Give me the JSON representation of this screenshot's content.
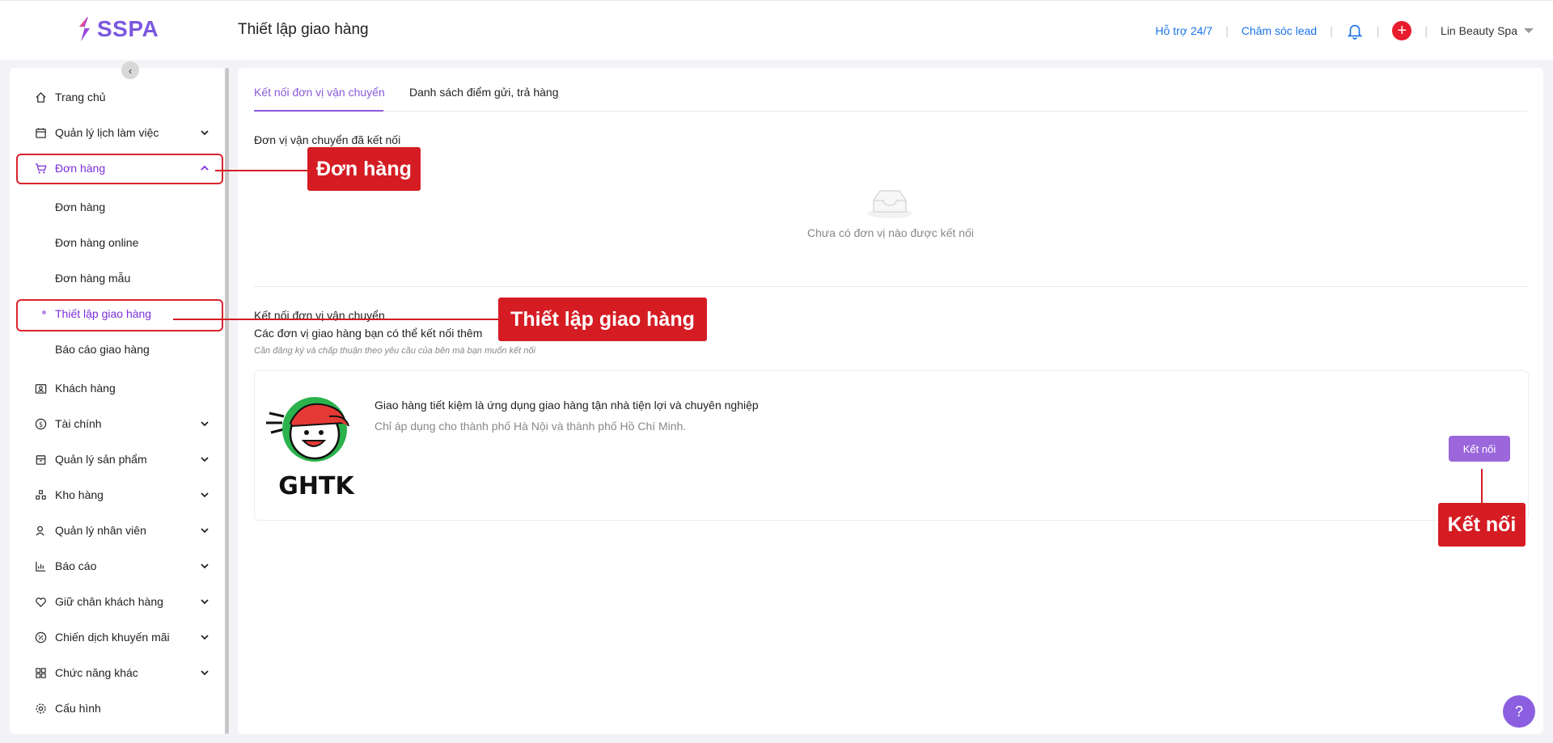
{
  "header": {
    "logo_text": "SSPA",
    "page_title": "Thiết lập giao hàng",
    "support_link": "Hỗ trợ 24/7",
    "lead_link": "Chăm sóc lead",
    "user_name": "Lin Beauty Spa"
  },
  "sidebar": {
    "items": [
      {
        "label": "Trang chủ",
        "icon": "home-icon"
      },
      {
        "label": "Quản lý lịch làm việc",
        "icon": "calendar-icon"
      },
      {
        "label": "Đơn hàng",
        "icon": "cart-icon"
      },
      {
        "label": "Khách hàng",
        "icon": "contact-card-icon"
      },
      {
        "label": "Tài chính",
        "icon": "dollar-icon"
      },
      {
        "label": "Quản lý sản phẩm",
        "icon": "box-icon"
      },
      {
        "label": "Kho hàng",
        "icon": "warehouse-icon"
      },
      {
        "label": "Quản lý nhân viên",
        "icon": "staff-icon"
      },
      {
        "label": "Báo cáo",
        "icon": "chart-icon"
      },
      {
        "label": "Giữ chân khách hàng",
        "icon": "heart-icon"
      },
      {
        "label": "Chiến dịch khuyến mãi",
        "icon": "discount-icon"
      },
      {
        "label": "Chức năng khác",
        "icon": "grid-icon"
      },
      {
        "label": "Cấu hình",
        "icon": "gear-icon"
      }
    ],
    "sub_items": [
      {
        "label": "Đơn hàng"
      },
      {
        "label": "Đơn hàng online"
      },
      {
        "label": "Đơn hàng mẫu"
      },
      {
        "label": "Thiết lập giao hàng"
      },
      {
        "label": "Báo cáo giao hàng"
      }
    ]
  },
  "main": {
    "tabs": [
      {
        "label": "Kết nối đơn vị vận chuyển"
      },
      {
        "label": "Danh sách điểm gửi, trả hàng"
      }
    ],
    "connected_title": "Đơn vị vận chuyển đã kết nối",
    "empty_text": "Chưa có đơn vị nào được kết nối",
    "connect_title": "Kết nối đơn vị vận chuyển",
    "available_title": "Các đơn vị giao hàng bạn có thể kết nối thêm",
    "hint": "Cần đăng ký và chấp thuận theo yêu cầu của bên mà bạn muốn kết nối",
    "carrier": {
      "logo_text": "GHTK",
      "title": "Giao hàng tiết kiệm là ứng dụng giao hàng tận nhà tiện lợi và chuyên nghiệp",
      "subtitle": "Chỉ áp dụng cho thành phố Hà Nội và thành phố Hồ Chí Minh.",
      "button": "Kết nối"
    }
  },
  "annotations": {
    "orders": "Đơn hàng",
    "shipping_setup": "Thiết lập giao hàng",
    "connect": "Kết nối"
  },
  "colors": {
    "accent": "#7b2fd8",
    "button": "#9b67db",
    "annotation": "#d51c23"
  }
}
